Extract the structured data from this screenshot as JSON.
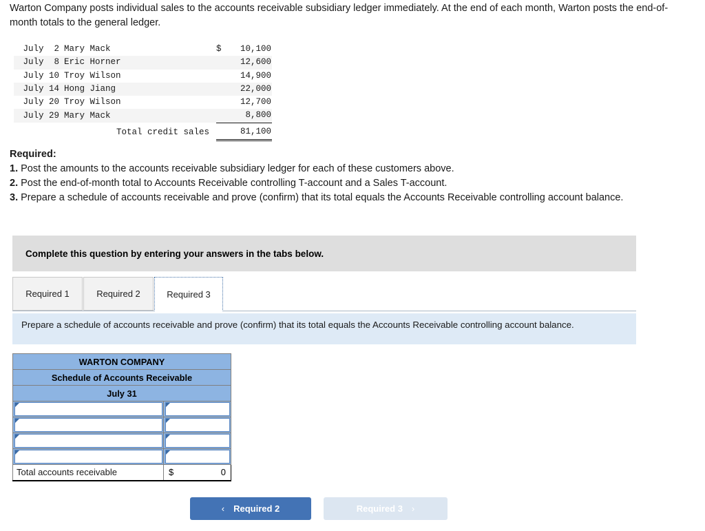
{
  "intro": {
    "paragraph": "Warton Company posts individual sales to the accounts receivable subsidiary ledger immediately. At the end of each month, Warton posts the end-of-month totals to the general ledger."
  },
  "ledger": {
    "rows": [
      {
        "date": "July  2",
        "name": "Mary Mack",
        "currency": "$",
        "amount": "10,100"
      },
      {
        "date": "July  8",
        "name": "Eric Horner",
        "currency": "",
        "amount": "12,600"
      },
      {
        "date": "July 10",
        "name": "Troy Wilson",
        "currency": "",
        "amount": "14,900"
      },
      {
        "date": "July 14",
        "name": "Hong Jiang",
        "currency": "",
        "amount": "22,000"
      },
      {
        "date": "July 20",
        "name": "Troy Wilson",
        "currency": "",
        "amount": "12,700"
      },
      {
        "date": "July 29",
        "name": "Mary Mack",
        "currency": "",
        "amount": "8,800"
      }
    ],
    "total_label": "Total credit sales",
    "total_amount": "81,100"
  },
  "required": {
    "heading": "Required:",
    "items": [
      {
        "num": "1.",
        "text": " Post the amounts to the accounts receivable subsidiary ledger for each of these customers above."
      },
      {
        "num": "2.",
        "text": " Post the end-of-month total to Accounts Receivable controlling T-account and a Sales T-account."
      },
      {
        "num": "3.",
        "text": " Prepare a schedule of accounts receivable and prove (confirm) that its total equals the Accounts Receivable controlling account balance."
      }
    ]
  },
  "banner": {
    "text": "Complete this question by entering your answers in the tabs below."
  },
  "tabs": [
    {
      "label": "Required 1",
      "active": false
    },
    {
      "label": "Required 2",
      "active": false
    },
    {
      "label": "Required 3",
      "active": true
    }
  ],
  "prompt": {
    "text": "Prepare a schedule of accounts receivable and prove (confirm) that its total equals the Accounts Receivable controlling account balance."
  },
  "schedule": {
    "title_line_1": "WARTON COMPANY",
    "title_line_2": "Schedule of Accounts Receivable",
    "title_line_3": "July 31",
    "entry_rows": [
      {
        "name": "",
        "amount": ""
      },
      {
        "name": "",
        "amount": ""
      },
      {
        "name": "",
        "amount": ""
      },
      {
        "name": "",
        "amount": ""
      }
    ],
    "total_label": "Total accounts receivable",
    "total_currency": "$",
    "total_amount": "0"
  },
  "nav": {
    "prev_label": "Required 2",
    "prev_chevron": "‹",
    "next_label": "Required 3",
    "next_chevron": "›"
  },
  "colors": {
    "header_blue": "#8db4e2",
    "prompt_blue": "#deeaf6",
    "banner_gray": "#dedede",
    "button_blue": "#4373b5",
    "button_disabled": "#dce6f1",
    "input_border": "#5b86bf"
  }
}
